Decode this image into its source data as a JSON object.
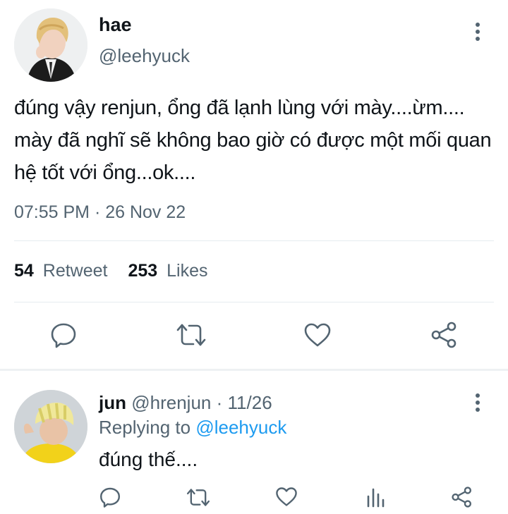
{
  "main_tweet": {
    "display_name": "hae",
    "handle": "@leehyuck",
    "text": "đúng vậy renjun, ổng đã lạnh lùng với mày....ừm.... mày đã nghĩ sẽ không bao giờ có được một mối quan hệ tốt với ổng...ok....",
    "timestamp": "07:55 PM · 26 Nov 22",
    "retweet_count": "54",
    "retweet_label": "Retweet",
    "like_count": "253",
    "like_label": "Likes",
    "avatar_icon": "user-avatar-blonde",
    "actions": [
      "reply-icon",
      "retweet-icon",
      "like-icon",
      "share-icon"
    ]
  },
  "reply": {
    "display_name": "jun",
    "handle": "@hrenjun",
    "separator": "·",
    "date": "11/26",
    "replying_to_label": "Replying to",
    "replying_to_handle": "@leehyuck",
    "text": "đúng thế....",
    "avatar_icon": "user-avatar-yellow-hat",
    "actions": [
      "reply-icon",
      "retweet-icon",
      "like-icon",
      "analytics-icon",
      "share-icon"
    ]
  },
  "colors": {
    "accent": "#1d9bf0",
    "text": "#0f1419",
    "muted": "#536471",
    "icon": "#536471"
  }
}
